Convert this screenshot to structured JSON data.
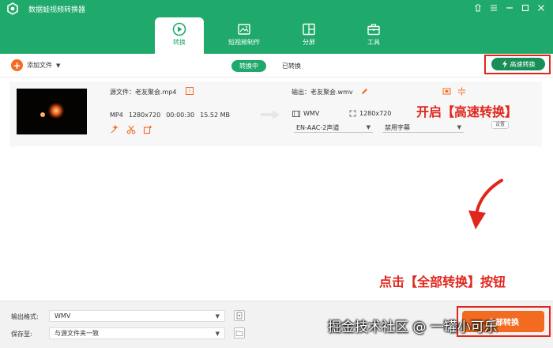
{
  "app": {
    "title": "数据蛙视频转换器"
  },
  "nav": {
    "tabs": [
      {
        "label": "转换",
        "icon": "convert-icon",
        "active": true
      },
      {
        "label": "短视频制作",
        "icon": "video-maker-icon",
        "active": false
      },
      {
        "label": "分屏",
        "icon": "split-screen-icon",
        "active": false
      },
      {
        "label": "工具",
        "icon": "toolbox-icon",
        "active": false
      }
    ]
  },
  "toolbar": {
    "add_file_label": "添加文件",
    "status_tabs": [
      {
        "label": "转换中",
        "active": true
      },
      {
        "label": "已转换",
        "active": false
      }
    ],
    "high_speed_label": "高速转换"
  },
  "file": {
    "source_name": "源文件：老友聚会.mp4",
    "format": "MP4",
    "resolution": "1280x720",
    "duration": "00:00:30",
    "size": "15.52 MB",
    "output_name": "输出：老友聚会.wmv",
    "output_format": "WMV",
    "output_resolution": "1280x720",
    "audio_track": "EN-AAC-2声道",
    "subtitle": "禁用字幕",
    "settings_label": "设置"
  },
  "annotations": {
    "top": "开启【高速转换】",
    "bottom": "点击【全部转换】按钮"
  },
  "bottom": {
    "output_format_label": "输出格式:",
    "output_format_value": "WMV",
    "save_to_label": "保存至:",
    "save_to_value": "与源文件夹一致",
    "convert_all_label": "全部转换"
  },
  "watermark": "掘金技术社区 @ 一罐小可乐",
  "colors": {
    "brand": "#1fa96b",
    "accent": "#f26b21",
    "annotation": "#e1261c"
  }
}
